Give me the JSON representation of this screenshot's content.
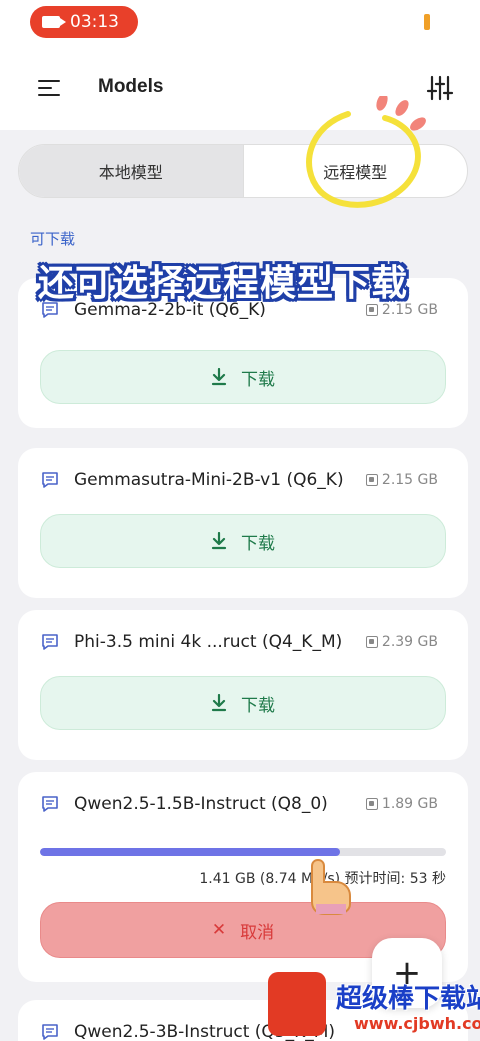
{
  "status": {
    "time": "03:13",
    "accent": "#e8402a"
  },
  "app_bar": {
    "title": "Models",
    "menu_icon": "menu-icon",
    "filter_icon": "sliders-icon"
  },
  "tabs": [
    {
      "label": "本地模型",
      "active": true
    },
    {
      "label": "远程模型",
      "active": false
    }
  ],
  "section_label": "可下载",
  "overlay_caption": "还可选择远程模型下载",
  "models": [
    {
      "name": "Gemma-2-2b-it (Q6_K)",
      "size": "2.15 GB",
      "action": "下载"
    },
    {
      "name": "Gemmasutra-Mini-2B-v1 (Q6_K)",
      "size": "2.15 GB",
      "action": "下载"
    },
    {
      "name": "Phi-3.5 mini 4k ...ruct (Q4_K_M)",
      "size": "2.39 GB",
      "action": "下载"
    },
    {
      "name": "Qwen2.5-1.5B-Instruct (Q8_0)",
      "size": "1.89 GB",
      "action": "取消"
    },
    {
      "name": "Qwen2.5-3B-Instruct (Q5_K_M)",
      "size": ""
    }
  ],
  "downloading": {
    "progress": 0.74,
    "status_text": "1.41 GB (8.74 MB/s) 预计时间: 53 秒",
    "cancel_label": "取消"
  },
  "fab_label": "+",
  "watermark": {
    "text": "超级棒下载站",
    "url": "www.cjbwh.com"
  },
  "colors": {
    "download_bg": "#e6f6ee",
    "download_text": "#1f7a4a",
    "progress": "#6e73e6",
    "cancel_bg": "#f0a0a0",
    "cancel_text": "#d83a3a",
    "link": "#3a63c9"
  }
}
